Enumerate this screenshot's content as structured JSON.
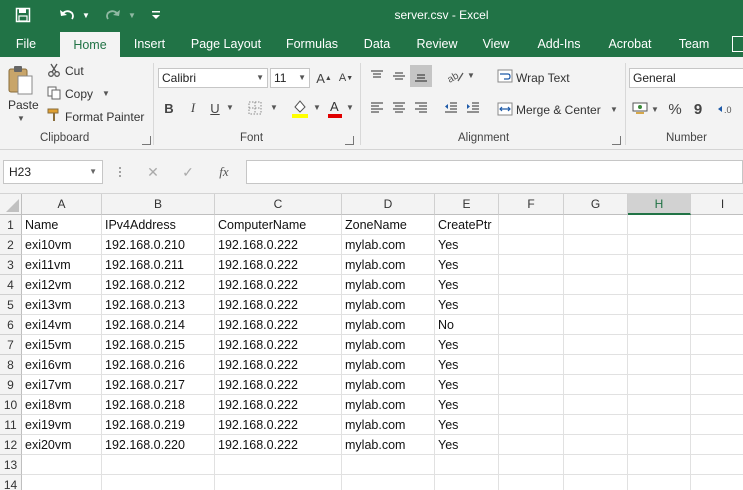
{
  "window": {
    "title": "server.csv - Excel"
  },
  "quick_access": {
    "save_icon": "save-icon",
    "undo_icon": "undo-icon",
    "redo_icon": "redo-icon",
    "customize_icon": "customize-qat-icon"
  },
  "tabs": [
    "File",
    "Home",
    "Insert",
    "Page Layout",
    "Formulas",
    "Data",
    "Review",
    "View",
    "Add-Ins",
    "Acrobat",
    "Team"
  ],
  "active_tab": "Home",
  "ribbon": {
    "clipboard": {
      "paste": "Paste",
      "cut": "Cut",
      "copy": "Copy",
      "format_painter": "Format Painter",
      "label": "Clipboard"
    },
    "font": {
      "name": "Calibri",
      "size": "11",
      "label": "Font",
      "bold": "B",
      "italic": "I",
      "underline": "U",
      "grow": "A",
      "shrink": "A"
    },
    "alignment": {
      "wrap_text": "Wrap Text",
      "merge_center": "Merge & Center",
      "label": "Alignment"
    },
    "number": {
      "format": "General",
      "percent": "%",
      "comma": "9",
      "label": "Number"
    }
  },
  "formula_bar": {
    "name_box": "H23",
    "cancel": "✕",
    "enter": "✓",
    "function": "fx",
    "value": ""
  },
  "sheet": {
    "columns": [
      "A",
      "B",
      "C",
      "D",
      "E",
      "F",
      "G",
      "H",
      "I"
    ],
    "selected_column": "H",
    "rows": [
      [
        "Name",
        "IPv4Address",
        "ComputerName",
        "ZoneName",
        "CreatePtr"
      ],
      [
        "exi10vm",
        "192.168.0.210",
        "192.168.0.222",
        "mylab.com",
        "Yes"
      ],
      [
        "exi11vm",
        "192.168.0.211",
        "192.168.0.222",
        "mylab.com",
        "Yes"
      ],
      [
        "exi12vm",
        "192.168.0.212",
        "192.168.0.222",
        "mylab.com",
        "Yes"
      ],
      [
        "exi13vm",
        "192.168.0.213",
        "192.168.0.222",
        "mylab.com",
        "Yes"
      ],
      [
        "exi14vm",
        "192.168.0.214",
        "192.168.0.222",
        "mylab.com",
        "No"
      ],
      [
        "exi15vm",
        "192.168.0.215",
        "192.168.0.222",
        "mylab.com",
        "Yes"
      ],
      [
        "exi16vm",
        "192.168.0.216",
        "192.168.0.222",
        "mylab.com",
        "Yes"
      ],
      [
        "exi17vm",
        "192.168.0.217",
        "192.168.0.222",
        "mylab.com",
        "Yes"
      ],
      [
        "exi18vm",
        "192.168.0.218",
        "192.168.0.222",
        "mylab.com",
        "Yes"
      ],
      [
        "exi19vm",
        "192.168.0.219",
        "192.168.0.222",
        "mylab.com",
        "Yes"
      ],
      [
        "exi20vm",
        "192.168.0.220",
        "192.168.0.222",
        "mylab.com",
        "Yes"
      ],
      [],
      []
    ]
  },
  "colors": {
    "brand": "#217346",
    "ribbon_bg": "#f3f3f3"
  }
}
